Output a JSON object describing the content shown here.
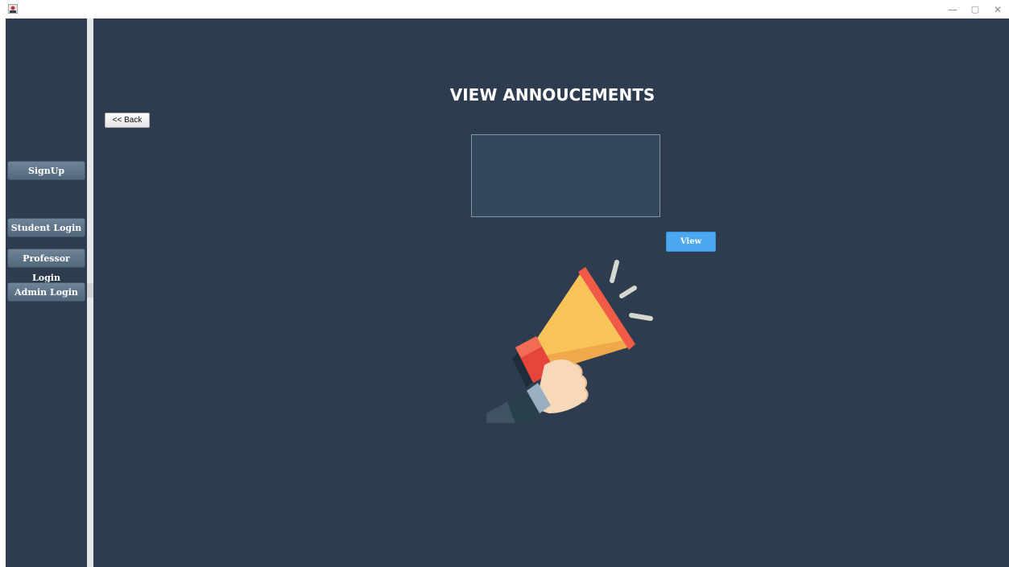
{
  "window": {
    "icon": "java-app-icon",
    "controls": {
      "minimize": "—",
      "maximize": "▢",
      "close": "✕"
    }
  },
  "sidebar": {
    "items": [
      {
        "label": "SignUp"
      },
      {
        "label": "Student Login"
      },
      {
        "label": "Professor Login"
      },
      {
        "label": "Admin Login"
      }
    ]
  },
  "main": {
    "back_label": "<< Back",
    "title": "VIEW ANNOUCEMENTS",
    "announcement_text": "",
    "view_label": "View",
    "illustration": "megaphone-icon"
  },
  "colors": {
    "background": "#2e3c4f",
    "accent": "#4ba8f0",
    "sidebar_button": "#5e7388"
  }
}
